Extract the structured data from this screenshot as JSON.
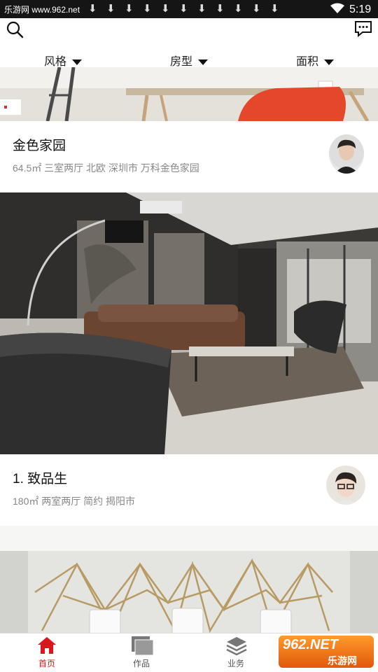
{
  "status_bar": {
    "watermark": "乐游网 www.962.net",
    "time": "5:19",
    "download_glyph": "⬇"
  },
  "header": {
    "search_icon": "search-icon",
    "message_icon": "chat-bubble-icon",
    "filters": [
      {
        "label": "风格"
      },
      {
        "label": "房型"
      },
      {
        "label": "面积"
      }
    ]
  },
  "cards": [
    {
      "title": "金色家园",
      "meta": "64.5㎡ 三室两厅 北欧 深圳市 万科金色家园"
    },
    {
      "title": "1. 致品生",
      "meta": "180㎡ 两室两厅 简约 揭阳市"
    }
  ],
  "bottom_nav": {
    "items": [
      {
        "label": "首页",
        "icon": "home-icon"
      },
      {
        "label": "作品",
        "icon": "gallery-icon"
      },
      {
        "label": "业务",
        "icon": "layers-icon"
      }
    ],
    "active_color": "#d8171e"
  },
  "watermark_badge": {
    "top": "962.NET",
    "bottom": "乐游网"
  }
}
